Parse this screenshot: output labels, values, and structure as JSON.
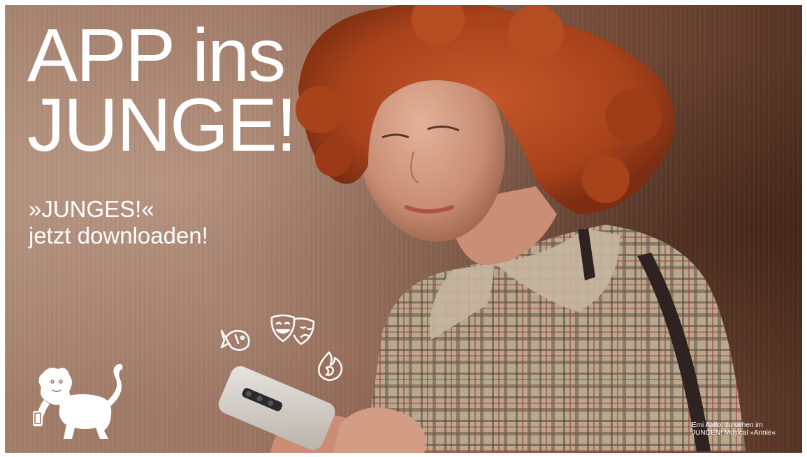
{
  "headline": {
    "line1": "APP ins",
    "line2": "JUNGE!"
  },
  "subline": {
    "line1": "»JUNGES!«",
    "line2": "jetzt downloaden!"
  },
  "caption": {
    "line1": "Emi Aalto, zu sehen im",
    "line2": "JUNGEN! Musical »Annie«"
  },
  "icons": [
    "fish-icon",
    "theater-masks-icon",
    "flame-icon",
    "lion-logo-icon"
  ],
  "colors": {
    "text": "#ffffff",
    "background": "#9d7663",
    "hair": "#b4481f",
    "shirt_plaid": "#b8a48a"
  }
}
